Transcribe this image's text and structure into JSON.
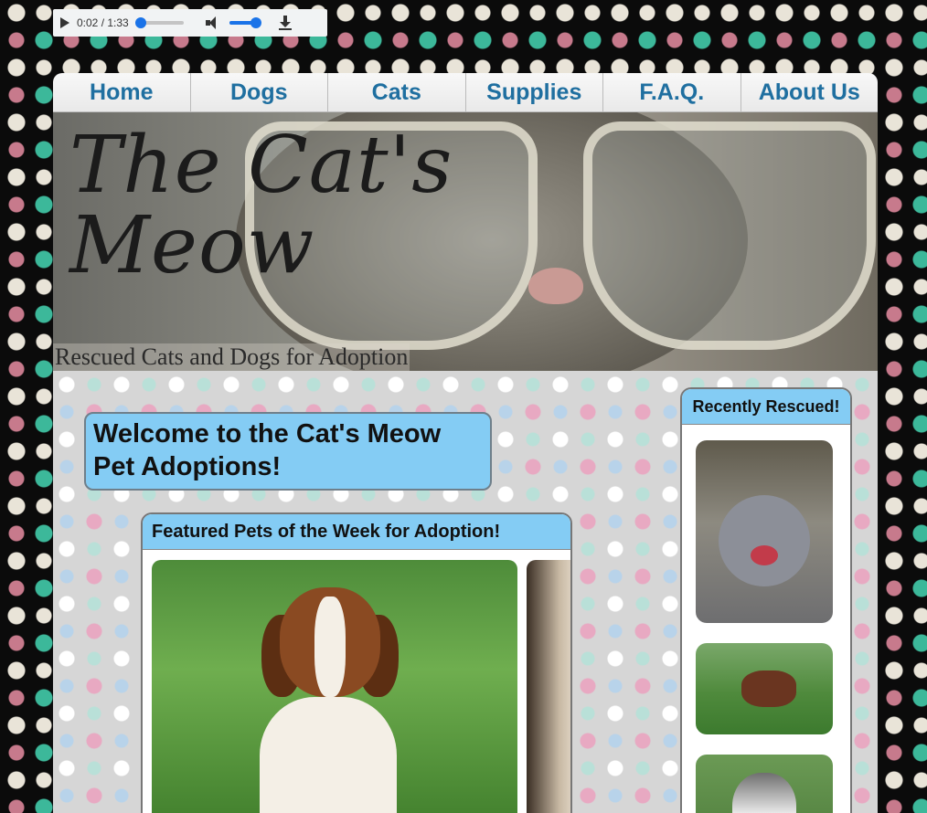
{
  "audio": {
    "time": "0:02 / 1:33",
    "progress_fraction": 0.02,
    "volume_fraction": 0.85
  },
  "nav": {
    "items": [
      {
        "label": "Home"
      },
      {
        "label": "Dogs"
      },
      {
        "label": "Cats"
      },
      {
        "label": "Supplies"
      },
      {
        "label": "F.A.Q."
      },
      {
        "label": "About Us"
      }
    ]
  },
  "banner": {
    "title_line1": "The Cat's",
    "title_line2": "Meow",
    "subtitle": "Rescued Cats and Dogs for Adoption"
  },
  "main": {
    "welcome_line1": "Welcome to the Cat's Meow",
    "welcome_line2": "Pet Adoptions!",
    "featured_title": "Featured Pets of the Week for Adoption!"
  },
  "sidebar": {
    "title": "Recently Rescued!"
  },
  "colors": {
    "nav_text": "#1f6fa0",
    "box_header": "#84ccf4",
    "progress": "#1a73e8"
  }
}
